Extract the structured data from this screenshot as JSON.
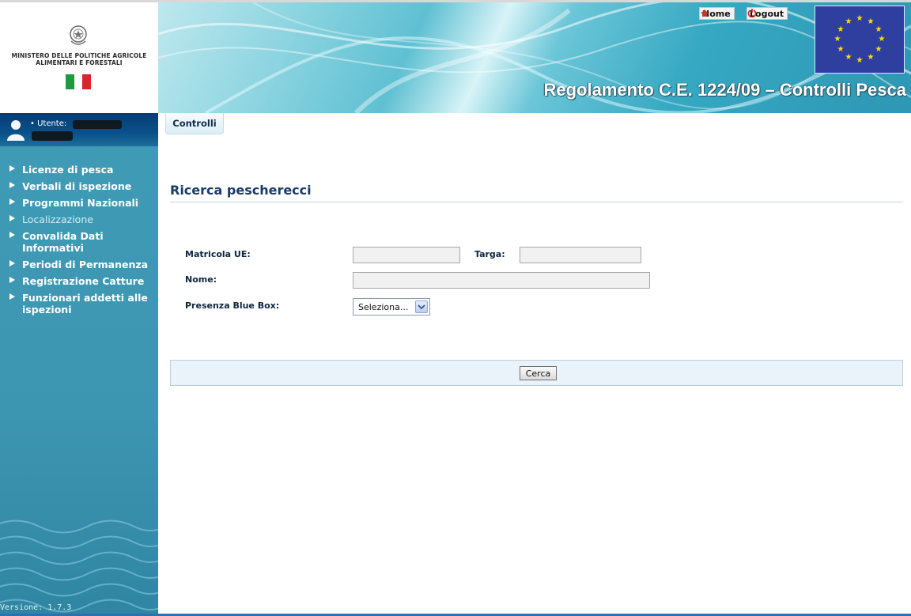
{
  "header": {
    "ministry_line1": "MINISTERO DELLE POLITICHE AGRICOLE",
    "ministry_line2": "ALIMENTARI E FORESTALI",
    "app_title": "Regolamento C.E. 1224/09 – Controlli Pesca",
    "home_label": "Home",
    "logout_label": "Logout"
  },
  "sidebar": {
    "user_label": "• Utente:",
    "menu": [
      {
        "label": "Licenze di pesca",
        "enabled": true
      },
      {
        "label": "Verbali di ispezione",
        "enabled": true
      },
      {
        "label": "Programmi Nazionali",
        "enabled": true
      },
      {
        "label": "Localizzazione",
        "enabled": false
      },
      {
        "label": "Convalida Dati Informativi",
        "enabled": true
      },
      {
        "label": "Periodi di Permanenza",
        "enabled": true
      },
      {
        "label": "Registrazione Catture",
        "enabled": true
      },
      {
        "label": "Funzionari addetti alle ispezioni",
        "enabled": true
      }
    ],
    "version": "Versione: 1.7.3"
  },
  "tabs": {
    "active": "Controlli"
  },
  "main": {
    "title": "Ricerca pescherecci",
    "form": {
      "matricola_label": "Matricola UE:",
      "matricola_value": "",
      "targa_label": "Targa:",
      "targa_value": "",
      "nome_label": "Nome:",
      "nome_value": "",
      "bluebox_label": "Presenza Blue Box:",
      "bluebox_selected": "Seleziona..."
    },
    "search_button": "Cerca"
  },
  "colors": {
    "sidebar": "#3d96b1",
    "userbar": "#0a5089",
    "title": "#1a3a6a",
    "button_bar": "#ebf3fa"
  }
}
